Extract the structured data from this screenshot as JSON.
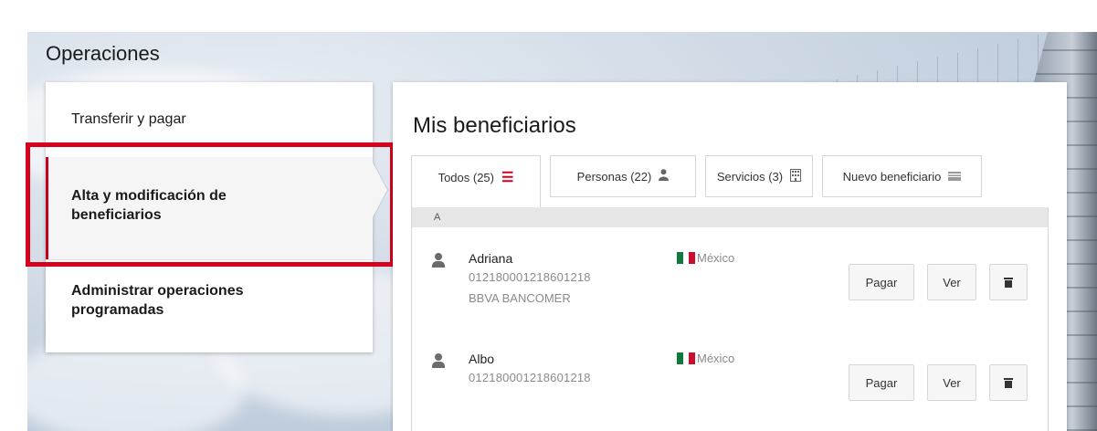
{
  "section_title": "Operaciones",
  "menu": {
    "items": [
      {
        "label": "Transferir y pagar"
      },
      {
        "label": "Alta y modificación de beneficiarios"
      },
      {
        "label": "Administrar operaciones programadas"
      }
    ]
  },
  "panel": {
    "title": "Mis beneficiarios",
    "tabs": [
      {
        "label": "Todos (25)",
        "icon": "list-icon"
      },
      {
        "label": "Personas (22)",
        "icon": "person-icon"
      },
      {
        "label": "Servicios (3)",
        "icon": "building-icon"
      },
      {
        "label": "Nuevo beneficiario",
        "icon": "card-icon"
      }
    ],
    "group_letter": "A",
    "beneficiaries": [
      {
        "name": "Adriana",
        "account": "012180001218601218",
        "bank": "BBVA BANCOMER",
        "country": "México"
      },
      {
        "name": "Albo",
        "account": "012180001218601218",
        "bank": "",
        "country": "México"
      }
    ],
    "actions": {
      "pay": "Pagar",
      "view": "Ver"
    }
  },
  "colors": {
    "accent": "#d6001c",
    "flag_green": "#0f7a3c",
    "flag_white": "#ffffff",
    "flag_red": "#c8102e"
  }
}
